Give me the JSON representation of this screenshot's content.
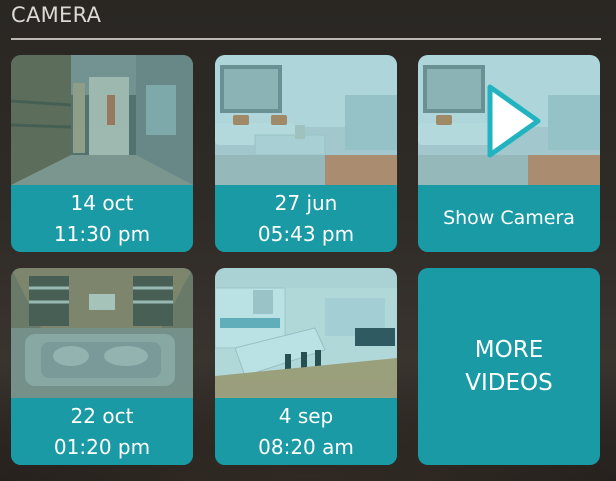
{
  "header": {
    "title": "CAMERA"
  },
  "tiles": [
    {
      "date": "14 oct",
      "time": "11:30 pm"
    },
    {
      "date": "27 jun",
      "time": "05:43 pm"
    },
    {
      "label": "Show Camera"
    },
    {
      "date": "22 oct",
      "time": "01:20 pm"
    },
    {
      "date": "4 sep",
      "time": "08:20 am"
    }
  ],
  "more": {
    "line1": "MORE",
    "line2": "VIDEOS"
  },
  "colors": {
    "tile": "#1a9aa5",
    "play_outline": "#22b3c0",
    "header_rule": "#bdb7b1"
  }
}
